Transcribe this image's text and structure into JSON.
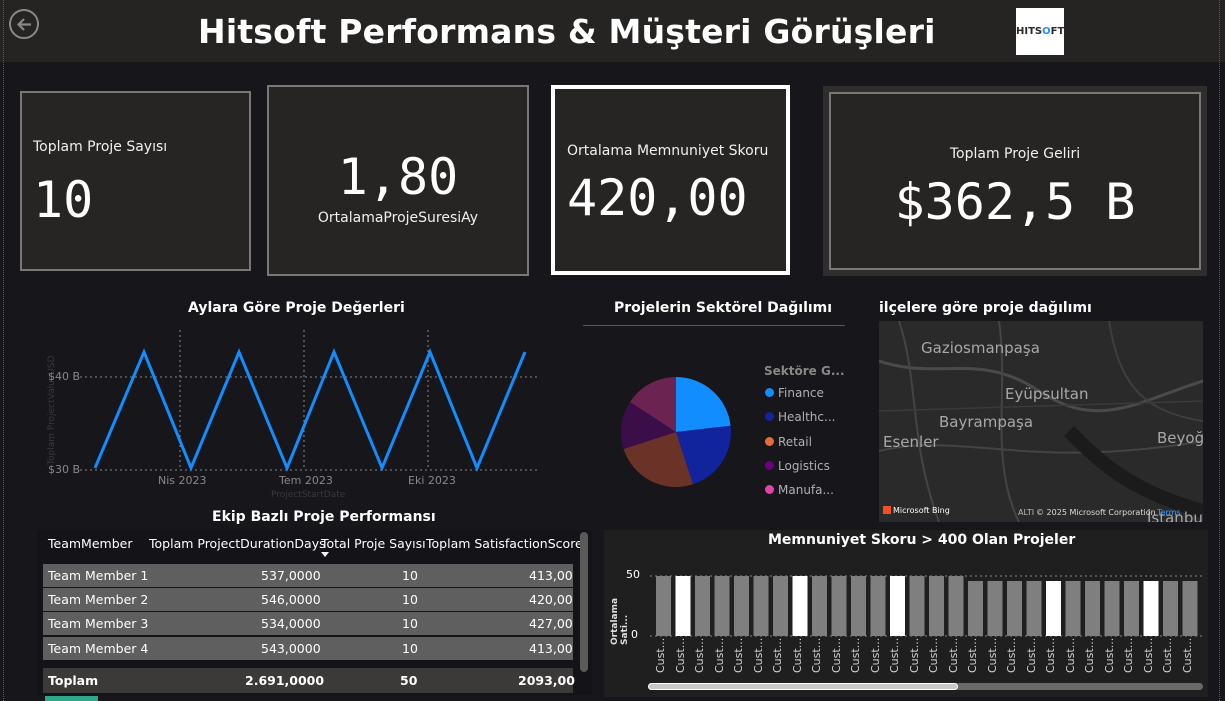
{
  "header": {
    "title": "Hitsoft Performans & Müşteri Görüşleri",
    "logo_text_a": "HITS",
    "logo_text_b": "O",
    "logo_text_c": "FT"
  },
  "kpis": {
    "total_projects": {
      "label": "Toplam Proje Sayısı",
      "value": "10"
    },
    "avg_duration": {
      "label": "OrtalamaProjeSuresiAy",
      "value": "1,80"
    },
    "avg_satisfaction": {
      "label": "Ortalama Memnuniyet Skoru",
      "value": "420,00"
    },
    "total_revenue": {
      "label": "Toplam Proje Geliri",
      "value": "$362,5 B"
    }
  },
  "line_chart": {
    "title": "Aylara Göre Proje Değerleri",
    "ylabel": "Toplam ProjectValueUSD",
    "xlabel": "ProjectStartDate",
    "y_ticks": [
      "$40 B",
      "$30 B"
    ],
    "x_ticks": [
      "Nis 2023",
      "Tem 2023",
      "Eki 2023"
    ]
  },
  "pie_chart": {
    "title": "Projelerin Sektörel Dağılımı",
    "legend_title": "Sektöre G...",
    "legend": [
      "Finance",
      "Healthc...",
      "Retail",
      "Logistics",
      "Manufa..."
    ]
  },
  "map": {
    "title": "ilçelere göre proje dağılımı",
    "places": [
      "Gaziosmanpaşa",
      "Eyüpsultan",
      "Bayrampaşa",
      "Esenler",
      "Beyoğl",
      "İstanbul"
    ],
    "brand": "Microsoft Bing",
    "copyright": "© 2025 Microsoft Corporation",
    "terms": "Terms",
    "altitude": "ALTI"
  },
  "table": {
    "title": "Ekip Bazlı Proje Performansı",
    "columns": [
      "TeamMember",
      "Toplam ProjectDurationDays",
      "Total Proje Sayısı",
      "Toplam SatisfactionScore"
    ],
    "rows": [
      [
        "Team Member 1",
        "537,0000",
        "10",
        "413,00"
      ],
      [
        "Team Member 2",
        "546,0000",
        "10",
        "420,00"
      ],
      [
        "Team Member 3",
        "534,0000",
        "10",
        "427,00"
      ],
      [
        "Team Member 4",
        "543,0000",
        "10",
        "413,00"
      ]
    ],
    "total": [
      "Toplam",
      "2.691,0000",
      "50",
      "2093,00"
    ]
  },
  "bar_chart": {
    "title": "Memnuniyet Skoru > 400 Olan Projeler",
    "ylabel": "Ortalama Sati...",
    "y_ticks": [
      "50",
      "0"
    ],
    "x_label": "Cust...",
    "bar_count": 28
  },
  "colors": {
    "accent": "#118dff",
    "background": "#16161b",
    "card": "#272524"
  }
}
